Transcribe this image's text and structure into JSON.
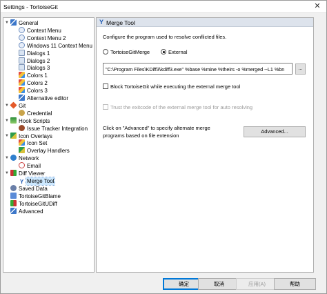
{
  "window": {
    "title": "Settings - TortoiseGit",
    "close_glyph": "✕"
  },
  "tree": {
    "items": [
      {
        "label": "General",
        "icon": "wrench-icon",
        "expander": "▼"
      },
      {
        "label": "Context Menu",
        "icon": "context-menu-icon"
      },
      {
        "label": "Context Menu 2",
        "icon": "context-menu-icon"
      },
      {
        "label": "Windows 11 Context Menu",
        "icon": "context-menu-icon"
      },
      {
        "label": "Dialogs 1",
        "icon": "dialog-icon"
      },
      {
        "label": "Dialogs 2",
        "icon": "dialog-icon"
      },
      {
        "label": "Dialogs 3",
        "icon": "dialog-icon"
      },
      {
        "label": "Colors 1",
        "icon": "palette-icon"
      },
      {
        "label": "Colors 2",
        "icon": "palette-icon"
      },
      {
        "label": "Colors 3",
        "icon": "palette-icon"
      },
      {
        "label": "Alternative editor",
        "icon": "editor-icon"
      },
      {
        "label": "Git",
        "icon": "git-icon",
        "expander": "▼"
      },
      {
        "label": "Credential",
        "icon": "credential-icon"
      },
      {
        "label": "Hook Scripts",
        "icon": "hook-icon",
        "expander": "▼"
      },
      {
        "label": "Issue Tracker Integration",
        "icon": "bug-icon"
      },
      {
        "label": "Icon Overlays",
        "icon": "overlay-icon",
        "expander": "▼"
      },
      {
        "label": "Icon Set",
        "icon": "icon-set-icon"
      },
      {
        "label": "Overlay Handlers",
        "icon": "overlay-handler-icon"
      },
      {
        "label": "Network",
        "icon": "network-icon",
        "expander": "▼"
      },
      {
        "label": "Email",
        "icon": "email-icon"
      },
      {
        "label": "Diff Viewer",
        "icon": "diff-icon",
        "expander": "▼"
      },
      {
        "label": "Merge Tool",
        "icon": "merge-icon"
      },
      {
        "label": "Saved Data",
        "icon": "saved-data-icon"
      },
      {
        "label": "TortoiseGitBlame",
        "icon": "blame-icon"
      },
      {
        "label": "TortoiseGitUDiff",
        "icon": "udiff-icon"
      },
      {
        "label": "Advanced",
        "icon": "advanced-icon"
      }
    ],
    "selected": "Merge Tool"
  },
  "panel": {
    "title": "Merge Tool",
    "title_icon": "merge-icon",
    "description": "Configure the program used to resolve conflicted files.",
    "radio_tortoise": "TortoiseGitMerge",
    "radio_external": "External",
    "selected_option": "External",
    "external_path": "\"C:\\Program Files\\KDiff3\\kdiff3.exe\"  %base %mine %theirs -o %merged --L1 %bn",
    "browse_label": "...",
    "block_label": "Block TortoiseGit while executing the external merge tool",
    "block_checked": false,
    "trust_label": "Trust the exitcode of the external merge tool for auto resolving",
    "trust_checked": false,
    "advanced_hint_line1": "Click on \"Advanced\" to specify alternate merge",
    "advanced_hint_line2": "programs based on file extension",
    "advanced_button": "Advanced..."
  },
  "footer": {
    "ok": "确定",
    "cancel": "取消",
    "apply": "应用(A)",
    "help": "帮助"
  }
}
